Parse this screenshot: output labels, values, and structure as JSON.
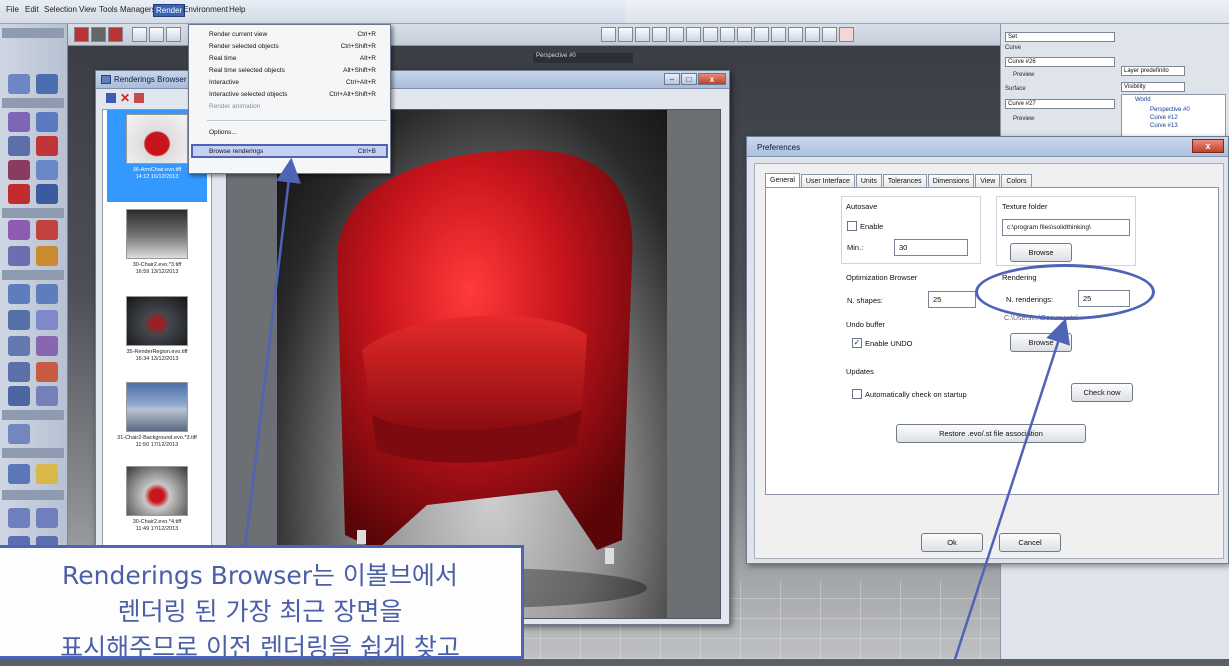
{
  "menubar": {
    "items": [
      "File",
      "Edit",
      "Selection",
      "View",
      "Tools",
      "Managers",
      "Render",
      "Environment",
      "Help"
    ],
    "active_item": "Render"
  },
  "render_menu": {
    "items": [
      {
        "label": "Render current view",
        "shortcut": "Ctrl+R"
      },
      {
        "label": "Render selected objects",
        "shortcut": "Ctrl+Shift+R"
      },
      {
        "label": "Real time",
        "shortcut": "Alt+R"
      },
      {
        "label": "Real time selected objects",
        "shortcut": "Alt+Shift+R"
      },
      {
        "label": "Interactive",
        "shortcut": "Ctrl+Alt+R"
      },
      {
        "label": "Interactive selected objects",
        "shortcut": "Ctrl+Alt+Shift+R"
      },
      {
        "label": "Render animation",
        "shortcut": ""
      },
      {
        "label": "Options...",
        "shortcut": ""
      },
      {
        "label": "Browse renderings",
        "shortcut": "Ctrl+B"
      }
    ]
  },
  "renderings_browser": {
    "title": "Renderings Browser",
    "items": [
      {
        "name": "36-ArmChair.evo.tiff",
        "date": "14:12 16/12/2013"
      },
      {
        "name": "30-Chair2.evo.*3.tiff",
        "date": "16:59 13/12/2013"
      },
      {
        "name": "35-RenderRegion.evo.tiff",
        "date": "16:34 13/12/2013"
      },
      {
        "name": "31-Chair2-Background.evo.*3.tiff",
        "date": "11:50 17/12/2013"
      },
      {
        "name": "30-Chair2.evo.*4.tiff",
        "date": "11:49 17/12/2013"
      }
    ]
  },
  "viewport": {
    "tab_label": "Perspective #0"
  },
  "right_panel": {
    "name_field": "Set",
    "curve_label": "Curve",
    "curve_field": "Curve #26",
    "preview_label": "Preview",
    "surface_label": "Surface",
    "surface_field": "Curve #27",
    "layer_dropdown": "Layer predefinito",
    "visibility_dropdown": "Visibility",
    "tree": [
      "World",
      "Perspective #0",
      "Curve #12",
      "Curve #13"
    ]
  },
  "preferences": {
    "title": "Preferences",
    "close_label": "x",
    "tabs": [
      "General",
      "User Interface",
      "Units",
      "Tolerances",
      "Dimensions",
      "View",
      "Colors"
    ],
    "autosave_label": "Autosave",
    "enable_label": "Enable",
    "min_label": "Min.:",
    "min_value": "30",
    "texture_folder_label": "Texture folder",
    "texture_folder_value": "c:\\program files\\solidthinking\\",
    "browse_label": "Browse",
    "optimization_label": "Optimization Browser",
    "nshapes_label": "N. shapes:",
    "nshapes_value": "25",
    "rendering_label": "Rendering",
    "nrenderings_label": "N. renderings:",
    "nrenderings_value": "25",
    "rendering_path": "C:\\Users\\...\\Documents\\",
    "browse2_label": "Browse",
    "undo_label": "Undo buffer",
    "enable_undo_label": "Enable UNDO",
    "updates_label": "Updates",
    "auto_check_label": "Automatically check on startup",
    "check_now_label": "Check now",
    "restore_label": "Restore .evo/.st file association",
    "ok_label": "Ok",
    "cancel_label": "Cancel"
  },
  "callout": {
    "line1": "Renderings Browser는 이볼브에서",
    "line2": "렌더링 된 가장 최근 장면을",
    "line3": "표시해주므로 이전 렌더링을 쉽게 찾고"
  },
  "colors": {
    "accent": "#4f63b7",
    "chair_red": "#c8141c",
    "selection": "#3399ff"
  }
}
